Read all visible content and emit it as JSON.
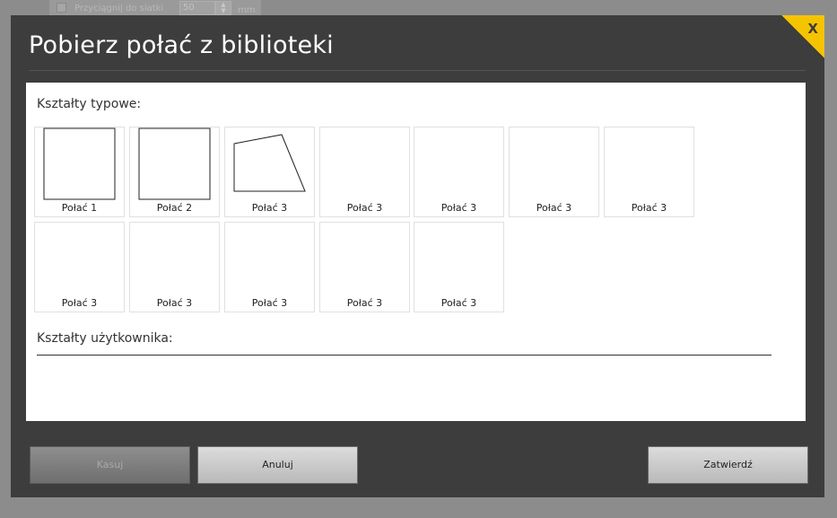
{
  "background": {
    "snap_label": "Przyciągnij do siatki",
    "snap_value": "50",
    "unit": "mm"
  },
  "dialog": {
    "title": "Pobierz połać z biblioteki",
    "close_label": "X",
    "accent_color": "#f5c400"
  },
  "sections": {
    "typical_label": "Kształty typowe:",
    "user_label": "Kształty użytkownika:"
  },
  "tiles": [
    {
      "label": "Połać 1",
      "shape": "square"
    },
    {
      "label": "Połać 2",
      "shape": "square"
    },
    {
      "label": "Połać 3",
      "shape": "quad"
    },
    {
      "label": "Połać 3",
      "shape": "none"
    },
    {
      "label": "Połać 3",
      "shape": "none"
    },
    {
      "label": "Połać 3",
      "shape": "none"
    },
    {
      "label": "Połać 3",
      "shape": "none"
    },
    {
      "label": "Połać 3",
      "shape": "none"
    },
    {
      "label": "Połać 3",
      "shape": "none"
    },
    {
      "label": "Połać 3",
      "shape": "none"
    },
    {
      "label": "Połać 3",
      "shape": "none"
    },
    {
      "label": "Połać 3",
      "shape": "none"
    }
  ],
  "buttons": {
    "delete": "Kasuj",
    "cancel": "Anuluj",
    "confirm": "Zatwierdź"
  }
}
